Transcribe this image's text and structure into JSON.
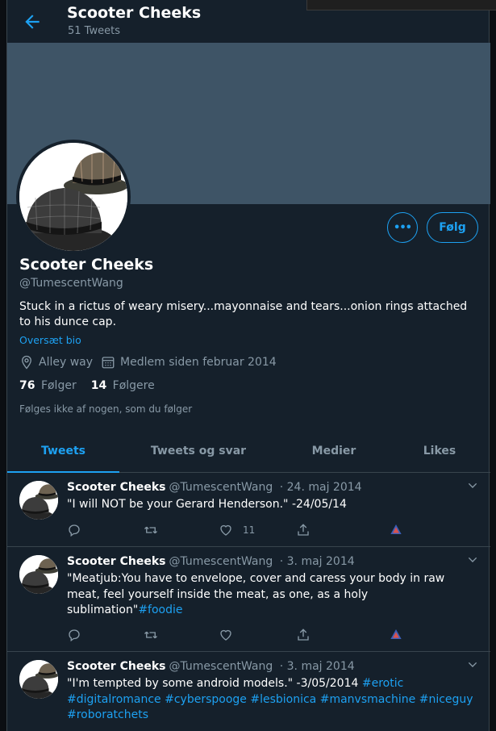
{
  "header": {
    "title": "Scooter Cheeks",
    "subtitle": "51 Tweets",
    "back_icon": "arrow-left-icon"
  },
  "profile": {
    "name": "Scooter Cheeks",
    "handle": "@TumescentWang",
    "bio": "Stuck in a rictus of weary misery...mayonnaise and tears...onion rings attached to his dunce cap.",
    "translate_bio": "Oversæt bio",
    "location": "Alley way",
    "joined": "Medlem siden februar 2014",
    "following_count": "76",
    "following_label": "Følger",
    "followers_count": "14",
    "followers_label": "Følgere",
    "not_followed": "Følges ikke af nogen, som du følger",
    "more_label": "•••",
    "follow_label": "Følg"
  },
  "tabs": [
    "Tweets",
    "Tweets og svar",
    "Medier",
    "Likes"
  ],
  "tweets": [
    {
      "name": "Scooter Cheeks",
      "handle": "@TumescentWang",
      "date": "24. maj 2014",
      "text": "\"I will NOT be your Gerard Henderson.\" -24/05/14",
      "hashtags": [],
      "likes": "11"
    },
    {
      "name": "Scooter Cheeks",
      "handle": "@TumescentWang",
      "date": "3. maj 2014",
      "text": "\"Meatjub:You have to envelope, cover and caress your body in raw meat, feel yourself inside the meat, as one, as a holy sublimation\"",
      "hashtags": [
        "#foodie"
      ],
      "likes": ""
    },
    {
      "name": "Scooter Cheeks",
      "handle": "@TumescentWang",
      "date": "3. maj 2014",
      "text": "\"I'm tempted by some android models.\" -3/05/2014 ",
      "hashtags": [
        "#erotic",
        "#digitalromance",
        "#cyberspooge",
        "#lesbionica",
        "#manvsmachine",
        "#niceguy",
        "#roboratchets"
      ],
      "likes": ""
    }
  ],
  "colors": {
    "accent": "#1da1f2",
    "background": "#15202b",
    "banner": "#3e5466",
    "muted": "#8899a6"
  }
}
